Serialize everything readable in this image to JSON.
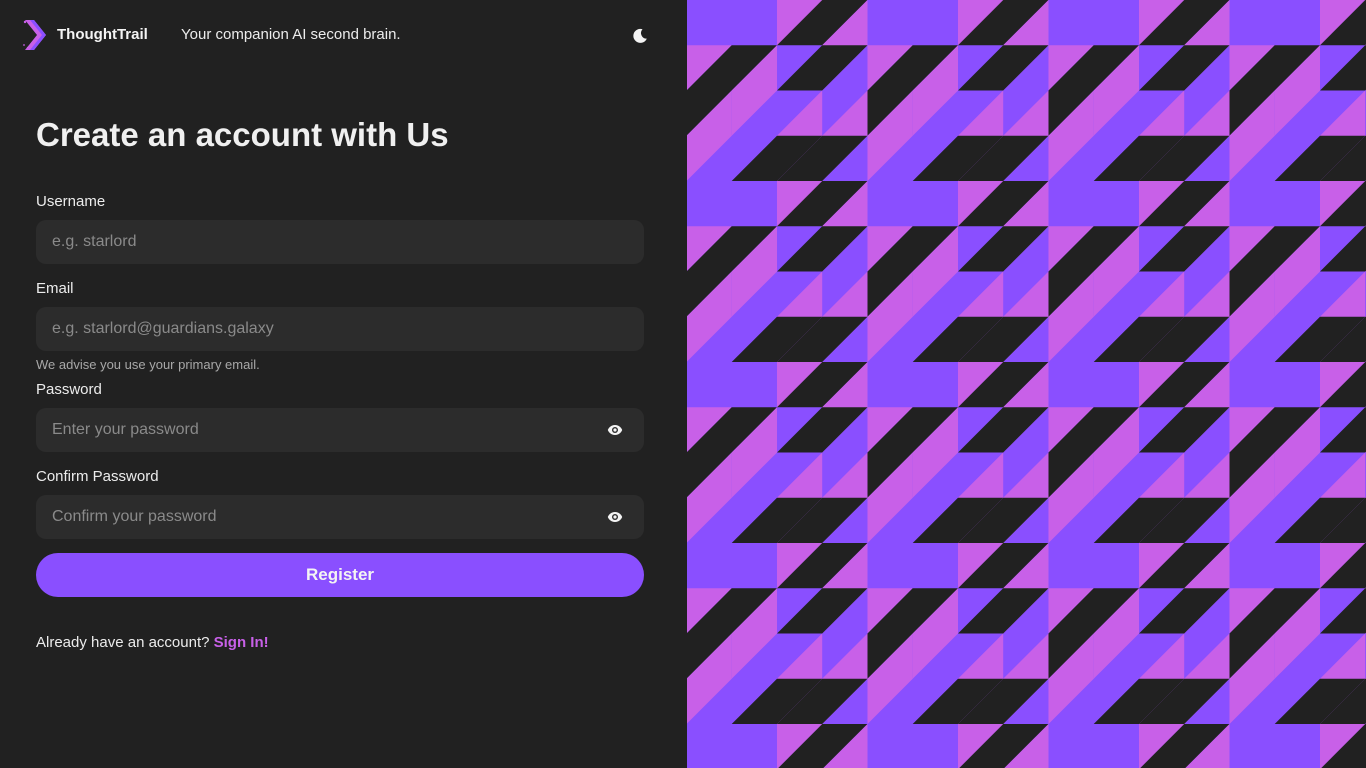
{
  "header": {
    "brand": "ThoughtTrail",
    "tagline": "Your companion AI second brain.",
    "logo_icon": "chevron-logo-icon",
    "theme_icon": "moon-icon"
  },
  "form": {
    "title": "Create an account with Us",
    "username": {
      "label": "Username",
      "placeholder": "e.g. starlord",
      "value": ""
    },
    "email": {
      "label": "Email",
      "placeholder": "e.g. starlord@guardians.galaxy",
      "value": "",
      "hint": "We advise you use your primary email."
    },
    "password": {
      "label": "Password",
      "placeholder": "Enter your password",
      "value": "",
      "toggle_icon": "eye-icon"
    },
    "confirm_password": {
      "label": "Confirm Password",
      "placeholder": "Confirm your password",
      "value": "",
      "toggle_icon": "eye-icon"
    },
    "submit_label": "Register",
    "signin_prompt": "Already have an account?",
    "signin_link": "Sign In!"
  },
  "colors": {
    "background": "#212121",
    "field": "#2c2c2c",
    "accent": "#8a4fff",
    "link": "#c860e8",
    "pattern_purple": "#8a4fff",
    "pattern_pink": "#c860e8",
    "pattern_dark": "#212121"
  }
}
